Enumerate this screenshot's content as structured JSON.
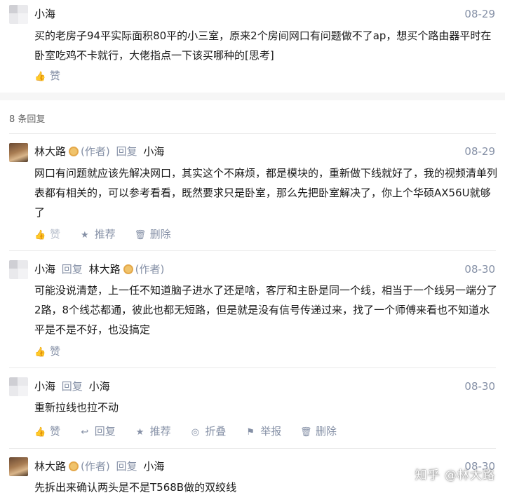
{
  "main_comment": {
    "author": "小海",
    "date": "08-29",
    "text": "买的老房子94平实际面积80平的小三室，原来2个房间网口有问题做不了ap，想买个路由器平时在卧室吃鸡不卡就行，大佬指点一下该买哪种的[思考]",
    "like_label": "赞"
  },
  "reply_count": "8 条回复",
  "labels": {
    "author_tag": "(作者)",
    "reply": "回复"
  },
  "replies": [
    {
      "author": "林大路",
      "reply_to": "小海",
      "date": "08-29",
      "text": "网口有问题就应该先解决网口，其实这个不麻烦，都是模块的，重新做下线就好了，我的视频清单列表都有相关的，可以参考看看，既然要求只是卧室，那么先把卧室解决了，你上个华硕AX56U就够了",
      "actions": [
        "赞",
        "推荐",
        "删除"
      ]
    },
    {
      "author": "小海",
      "reply_to": "林大路",
      "date": "08-30",
      "text": "可能没说清楚，上一任不知道脑子进水了还是啥，客厅和主卧是同一个线，相当于一个线另一端分了2路，8个线芯都通，彼此也都无短路，但是就是没有信号传递过来，找了一个师傅来看也不知道水平是不是不好，也没搞定",
      "actions": [
        "赞"
      ]
    },
    {
      "author": "小海",
      "reply_to": "小海",
      "date": "08-30",
      "text": "重新拉线也拉不动",
      "actions": [
        "赞",
        "回复",
        "推荐",
        "折叠",
        "举报",
        "删除"
      ]
    },
    {
      "author": "林大路",
      "reply_to": "小海",
      "date": "08-30",
      "text": "先拆出来确认两头是不是T568B做的双绞线"
    }
  ],
  "watermark": "知乎 @林大路"
}
